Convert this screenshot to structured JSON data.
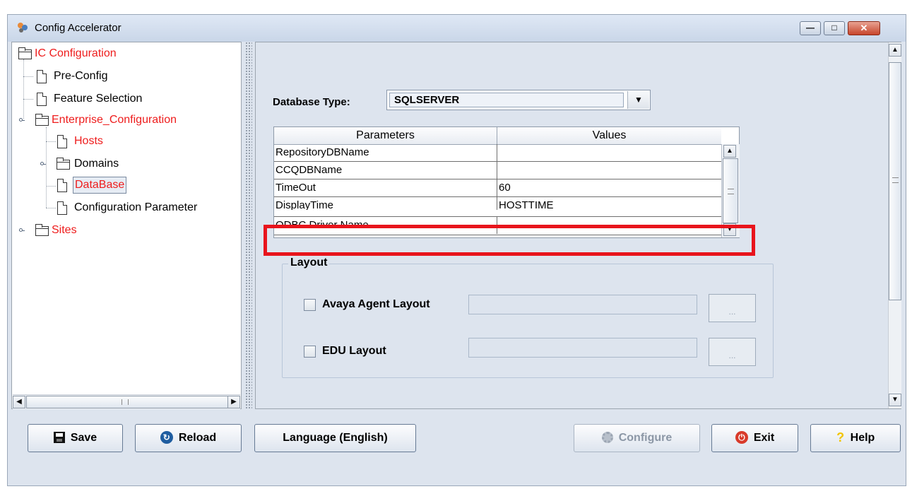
{
  "window": {
    "title": "Config Accelerator",
    "controls": {
      "minimize": "—",
      "maximize": "□",
      "close": "✕"
    }
  },
  "tree": {
    "nodes": [
      {
        "label": "IC Configuration",
        "type": "folder",
        "color": "red"
      },
      {
        "label": "Pre-Config",
        "type": "doc"
      },
      {
        "label": "Feature Selection",
        "type": "doc"
      },
      {
        "label": "Enterprise_Configuration",
        "type": "folder",
        "color": "red",
        "expanded": true
      },
      {
        "label": "Hosts",
        "type": "doc",
        "color": "red"
      },
      {
        "label": "Domains",
        "type": "folder",
        "collapsed": true
      },
      {
        "label": "DataBase",
        "type": "doc",
        "color": "red",
        "selected": true
      },
      {
        "label": "Configuration Parameter",
        "type": "doc"
      },
      {
        "label": "Sites",
        "type": "folder",
        "color": "red",
        "collapsed": true
      }
    ]
  },
  "main": {
    "database_type_label": "Database Type:",
    "database_type_value": "SQLSERVER",
    "table": {
      "columns": [
        "Parameters",
        "Values"
      ],
      "rows": [
        [
          "RepositoryDBName",
          ""
        ],
        [
          "CCQDBName",
          ""
        ],
        [
          "TimeOut",
          "60"
        ],
        [
          "DisplayTime",
          "HOSTTIME"
        ],
        [
          "ODBC Driver Name",
          ""
        ]
      ]
    },
    "layout_group": {
      "legend": "Layout",
      "items": [
        {
          "label": "Avaya Agent Layout",
          "checked": false,
          "value": "",
          "browse": "..."
        },
        {
          "label": "EDU Layout",
          "checked": false,
          "value": "",
          "browse": "..."
        }
      ]
    }
  },
  "buttons": {
    "save": "Save",
    "reload": "Reload",
    "language": "Language (English)",
    "configure": "Configure",
    "exit": "Exit",
    "help": "Help"
  },
  "colors": {
    "highlight": "#e8141c",
    "tree_red": "#ee1c1c",
    "panel_bg": "#dde4ee"
  }
}
